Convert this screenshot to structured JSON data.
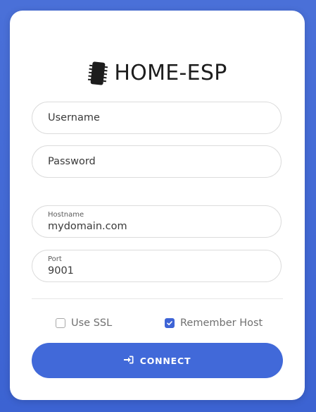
{
  "brand": {
    "title": "HOME-ESP",
    "icon": "microchip-icon"
  },
  "login": {
    "username_placeholder": "Username",
    "password_placeholder": "Password"
  },
  "host": {
    "hostname_label": "Hostname",
    "hostname_value": "mydomain.com",
    "port_label": "Port",
    "port_value": "9001"
  },
  "options": {
    "ssl_label": "Use SSL",
    "ssl_checked": false,
    "remember_label": "Remember Host",
    "remember_checked": true
  },
  "connect": {
    "label": "CONNECT",
    "icon": "sign-in-icon"
  },
  "colors": {
    "background": "#4169d9",
    "accent": "#3e64d6",
    "card": "#ffffff"
  }
}
